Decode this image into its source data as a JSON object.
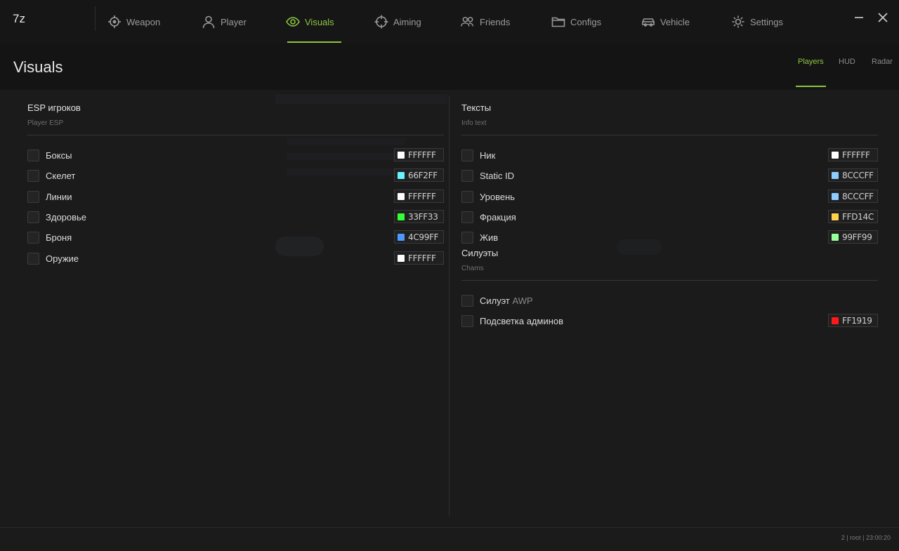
{
  "app": {
    "logo": "7z"
  },
  "nav": {
    "items": [
      {
        "label": "Weapon",
        "icon": "crosshair-icon"
      },
      {
        "label": "Player",
        "icon": "user-icon"
      },
      {
        "label": "Visuals",
        "icon": "eye-icon"
      },
      {
        "label": "Aiming",
        "icon": "target-icon"
      },
      {
        "label": "Friends",
        "icon": "users-icon"
      },
      {
        "label": "Configs",
        "icon": "folder-icon"
      },
      {
        "label": "Vehicle",
        "icon": "car-icon"
      },
      {
        "label": "Settings",
        "icon": "gear-icon"
      }
    ],
    "active": "Visuals",
    "accent": "#8dc63f"
  },
  "header": {
    "title": "Visuals",
    "subtabs": [
      "Players",
      "HUD",
      "Radar"
    ],
    "active_subtab": "Players"
  },
  "esp": {
    "title_prefix": "ESP",
    "title_rest": "игроков",
    "subtitle": "Player ESP",
    "rows": [
      {
        "label": "Боксы",
        "color": "FFFFFF",
        "chip": "#FFFFFF"
      },
      {
        "label": "Скелет",
        "color": "66F2FF",
        "chip": "#66F2FF"
      },
      {
        "label": "Линии",
        "color": "FFFFFF",
        "chip": "#FFFFFF"
      },
      {
        "label": "Здоровье",
        "color": "33FF33",
        "chip": "#33FF33"
      },
      {
        "label": "Броня",
        "color": "4C99FF",
        "chip": "#4C99FF"
      },
      {
        "label": "Оружие",
        "color": "FFFFFF",
        "chip": "#FFFFFF"
      }
    ]
  },
  "texts": {
    "title": "Тексты",
    "subtitle": "Info text",
    "rows": [
      {
        "label": "Ник",
        "color": "FFFFFF",
        "chip": "#FFFFFF"
      },
      {
        "label": "Static ID",
        "color": "8CCCFF",
        "chip": "#8CCCFF"
      },
      {
        "label": "Уровень",
        "color": "8CCCFF",
        "chip": "#8CCCFF"
      },
      {
        "label": "Фракция",
        "color": "FFD14C",
        "chip": "#FFD14C"
      },
      {
        "label": "Жив",
        "color": "99FF99",
        "chip": "#99FF99"
      }
    ]
  },
  "chams": {
    "title": "Силуэты",
    "subtitle": "Chams",
    "rows": [
      {
        "label": "Силуэт",
        "label_suffix": "AWP"
      },
      {
        "label": "Подсветка админов",
        "color": "FF1919",
        "chip": "#FF1919"
      }
    ]
  },
  "footer": {
    "status": "2 | root | 23:00:20"
  }
}
